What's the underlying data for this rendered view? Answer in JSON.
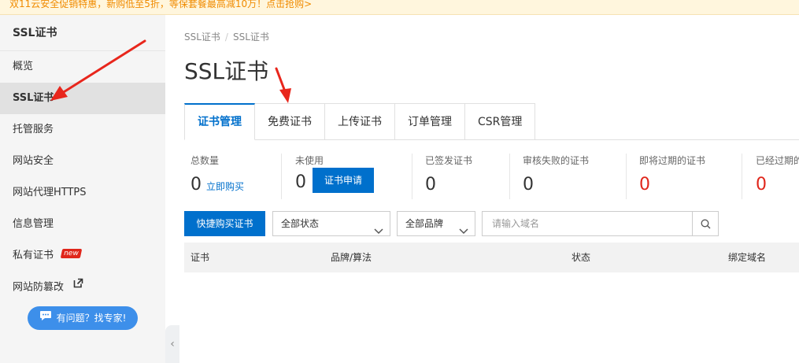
{
  "promo": {
    "text": "双11云安全促销特惠，新购低至5折，等保套餐最高减10万！点击抢购>"
  },
  "sidebar": {
    "title": "SSL证书",
    "items": [
      {
        "label": "概览"
      },
      {
        "label": "SSL证书"
      },
      {
        "label": "托管服务"
      },
      {
        "label": "网站安全"
      },
      {
        "label": "网站代理HTTPS"
      },
      {
        "label": "信息管理"
      },
      {
        "label": "私有证书",
        "badge": "new"
      },
      {
        "label": "网站防篡改"
      }
    ],
    "expert_button": "有问题？找专家!"
  },
  "breadcrumb": {
    "root": "SSL证书",
    "separator": "/",
    "current": "SSL证书"
  },
  "page_title": "SSL证书",
  "tabs": [
    {
      "label": "证书管理"
    },
    {
      "label": "免费证书"
    },
    {
      "label": "上传证书"
    },
    {
      "label": "订单管理"
    },
    {
      "label": "CSR管理"
    }
  ],
  "stats": [
    {
      "label": "总数量",
      "value": "0",
      "link": "立即购买"
    },
    {
      "label": "未使用",
      "value": "0",
      "button": "证书申请"
    },
    {
      "label": "已签发证书",
      "value": "0"
    },
    {
      "label": "审核失败的证书",
      "value": "0"
    },
    {
      "label": "即将过期的证书",
      "value": "0"
    },
    {
      "label": "已经过期的",
      "value": "0"
    }
  ],
  "toolbar": {
    "buy_button": "快捷购买证书",
    "status_select": "全部状态",
    "brand_select": "全部品牌",
    "search_placeholder": "请输入域名"
  },
  "table": {
    "columns": [
      "证书",
      "品牌/算法",
      "状态",
      "绑定域名"
    ]
  },
  "colors": {
    "primary": "#0070cc",
    "danger": "#e0261b",
    "promo_text": "#f08b00",
    "annotation_arrow": "#e8261c"
  },
  "icons": {
    "external_link": "external-link-icon",
    "search": "search-icon",
    "chevron": "chevron-down-icon",
    "chat": "chat-bubble-icon",
    "collapse": "chevron-left-icon"
  }
}
